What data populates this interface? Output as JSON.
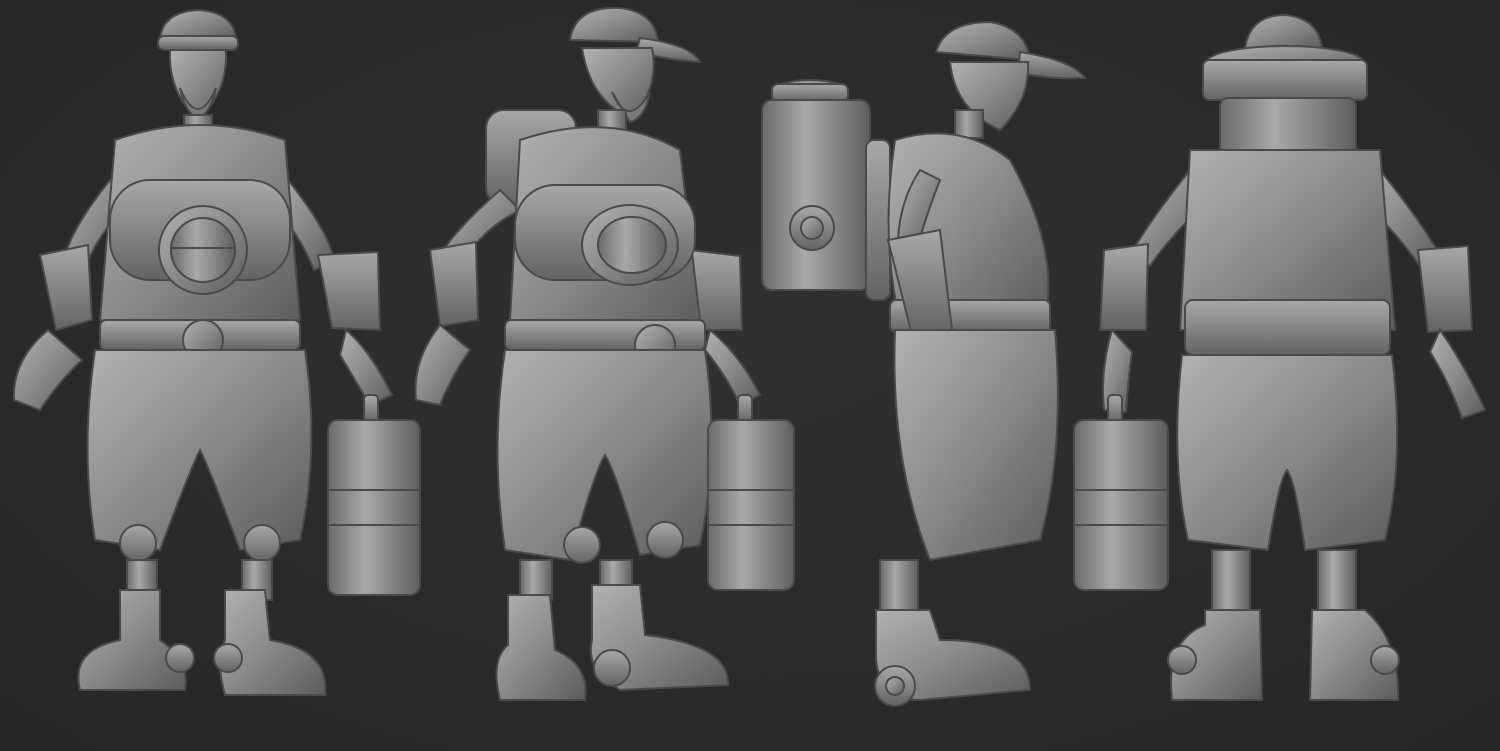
{
  "scene": {
    "background_color": "#2b2b2b",
    "clay_color": "#8c8c8c",
    "clay_shadow": "#5a5a5a",
    "clay_highlight": "#b0b0b0",
    "views": [
      {
        "name": "front"
      },
      {
        "name": "three-quarter"
      },
      {
        "name": "side"
      },
      {
        "name": "back"
      }
    ]
  }
}
